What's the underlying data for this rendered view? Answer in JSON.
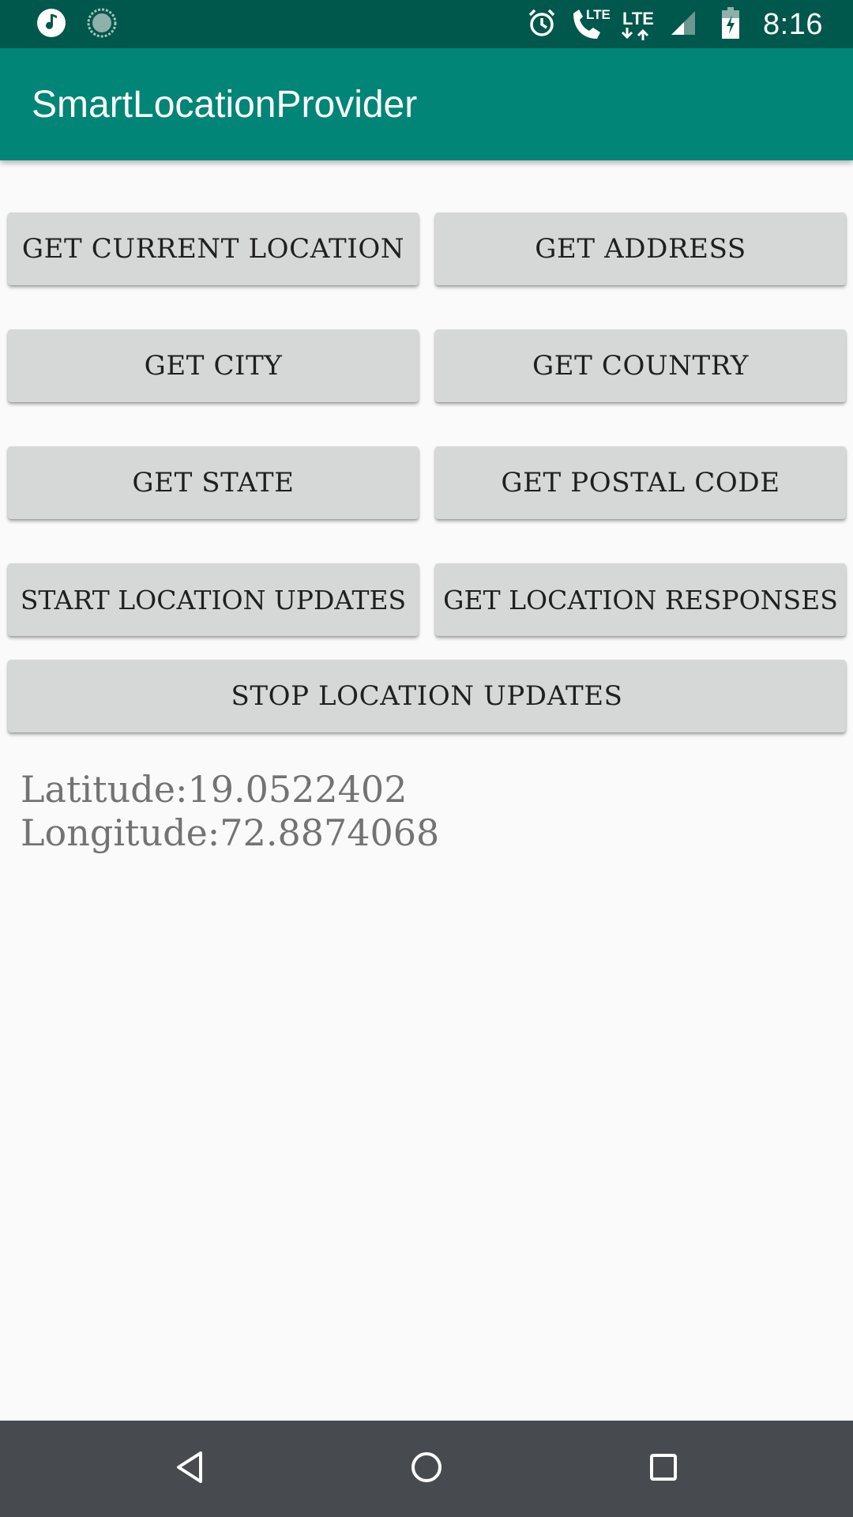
{
  "status_bar": {
    "time": "8:16",
    "lte_primary": "LTE",
    "lte_secondary": "LTE",
    "icons": [
      "music-note-icon",
      "sync-icon",
      "alarm-icon",
      "wifi-call-icon",
      "lte-icon",
      "lte-data-icon",
      "signal-icon",
      "battery-charging-icon"
    ],
    "color": "#00574b"
  },
  "app_bar": {
    "title": "SmartLocationProvider",
    "color": "#008577"
  },
  "buttons": {
    "get_current_location": "GET CURRENT LOCATION",
    "get_address": "GET ADDRESS",
    "get_city": "GET CITY",
    "get_country": "GET COUNTRY",
    "get_state": "GET STATE",
    "get_postal_code": "GET POSTAL CODE",
    "start_location_updates": "START LOCATION UPDATES",
    "get_location_responses": "GET LOCATION RESPONSES",
    "stop_location_updates": "STOP LOCATION UPDATES"
  },
  "result": {
    "latitude": "Latitude:19.0522402",
    "longitude": "Longitude:72.8874068"
  },
  "nav_bar": {
    "icons": [
      "back-icon",
      "home-icon",
      "recents-icon"
    ],
    "color": "#474b50"
  }
}
